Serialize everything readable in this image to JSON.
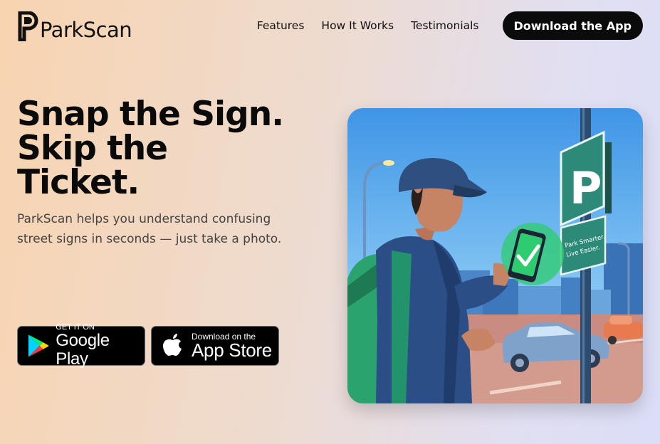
{
  "brand": {
    "name": "ParkScan",
    "initial": "P"
  },
  "nav": {
    "links": [
      "Features",
      "How It Works",
      "Testimonials"
    ],
    "cta": "Download the App"
  },
  "hero": {
    "title_lines": [
      "Snap the Sign.",
      "Skip the",
      "Ticket."
    ],
    "subtitle": "ParkScan helps you understand confusing street signs in seconds — just take a photo."
  },
  "stores": {
    "google": {
      "small": "GET IT ON",
      "big": "Google Play",
      "icon": "google-play-icon"
    },
    "apple": {
      "small": "Download on the",
      "big": "App Store",
      "icon": "apple-icon"
    }
  },
  "illustration": {
    "sign_letter": "P",
    "sign_text": [
      "Park Smarter.",
      "Live Easier."
    ]
  },
  "colors": {
    "cta_bg": "#0b0b0b",
    "sign_green": "#2d8a78",
    "check_green": "#2ecc71",
    "sky_blue": "#4a9ee8"
  }
}
